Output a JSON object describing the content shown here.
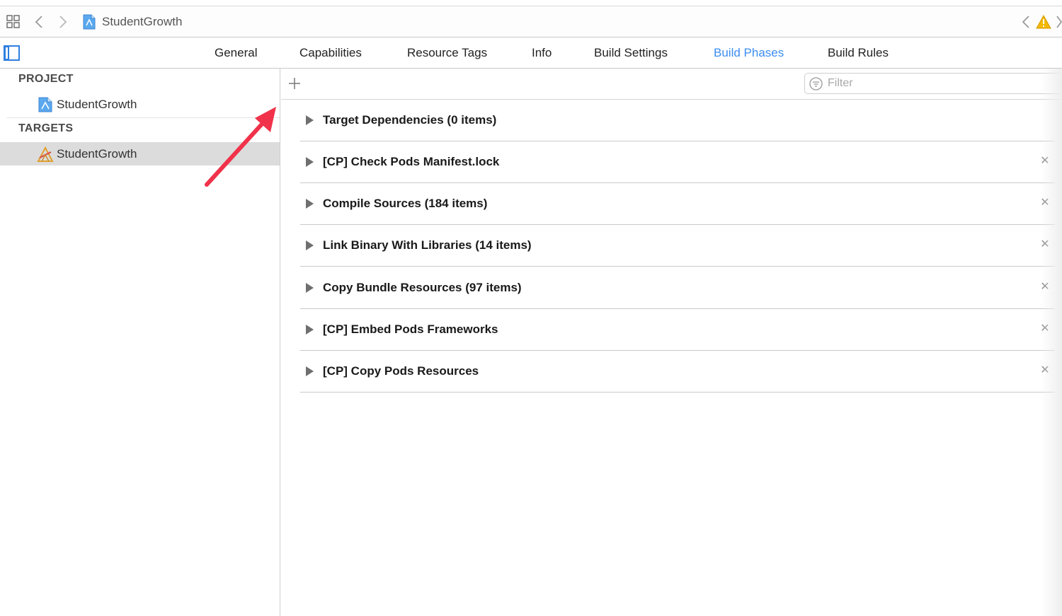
{
  "jumpbar": {
    "title": "StudentGrowth"
  },
  "tabs": [
    {
      "label": "General",
      "active": false
    },
    {
      "label": "Capabilities",
      "active": false
    },
    {
      "label": "Resource Tags",
      "active": false
    },
    {
      "label": "Info",
      "active": false
    },
    {
      "label": "Build Settings",
      "active": false
    },
    {
      "label": "Build Phases",
      "active": true
    },
    {
      "label": "Build Rules",
      "active": false
    }
  ],
  "sidebar": {
    "project_heading": "PROJECT",
    "project_item": "StudentGrowth",
    "targets_heading": "TARGETS",
    "target_item": "StudentGrowth"
  },
  "filter": {
    "placeholder": "Filter"
  },
  "phases": [
    {
      "title": "Target Dependencies (0 items)",
      "removable": false
    },
    {
      "title": "[CP] Check Pods Manifest.lock",
      "removable": true
    },
    {
      "title": "Compile Sources (184 items)",
      "removable": true
    },
    {
      "title": "Link Binary With Libraries (14 items)",
      "removable": true
    },
    {
      "title": "Copy Bundle Resources (97 items)",
      "removable": true
    },
    {
      "title": "[CP] Embed Pods Frameworks",
      "removable": true
    },
    {
      "title": "[CP] Copy Pods Resources",
      "removable": true
    }
  ],
  "colors": {
    "accent": "#3b8ef0",
    "annotation_arrow": "#f0324a",
    "warning": "#f5b800"
  },
  "close_glyph": "✕"
}
